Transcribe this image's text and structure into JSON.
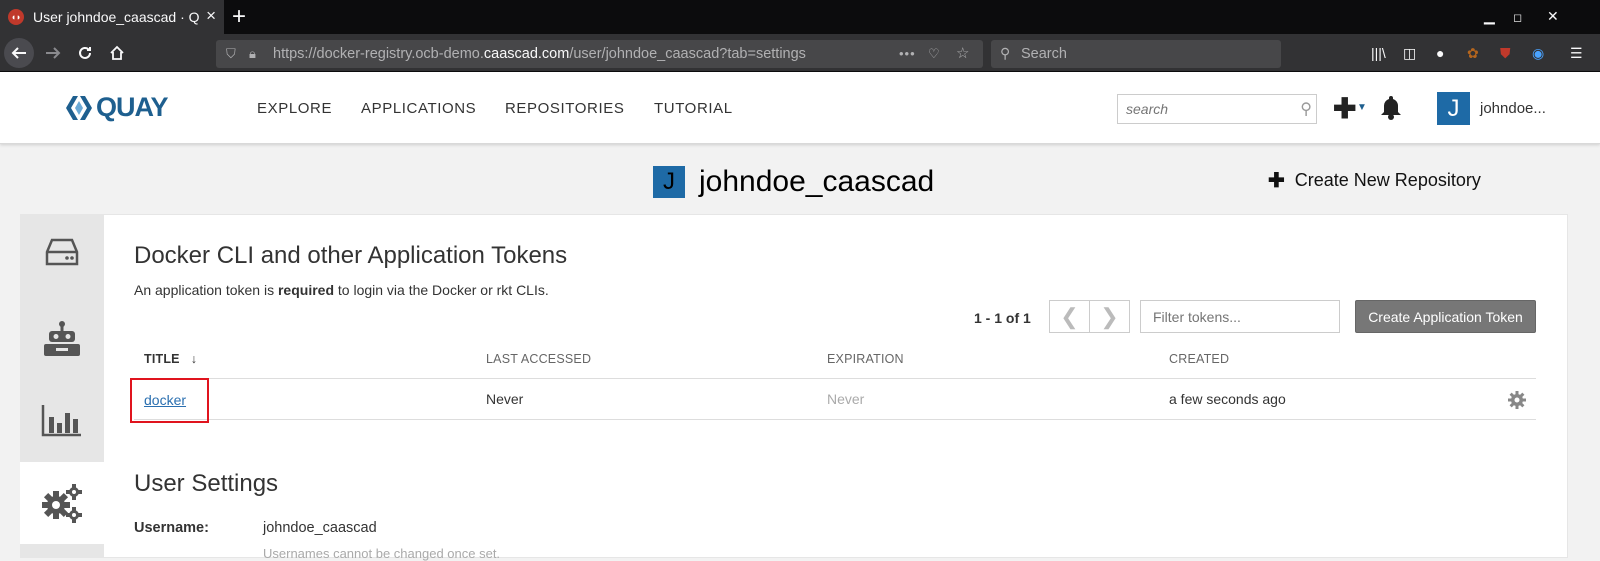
{
  "browser": {
    "tab_title": "User johndoe_caascad · Q",
    "tab_close": "×",
    "new_tab": "+",
    "url_prefix": "https://docker-registry.ocb-demo.",
    "url_domain": "caascad.com",
    "url_suffix": "/user/johndoe_caascad?tab=settings",
    "search_placeholder": "Search",
    "more": "•••"
  },
  "header": {
    "logo_text": "QUAY",
    "nav": [
      "EXPLORE",
      "APPLICATIONS",
      "REPOSITORIES",
      "TUTORIAL"
    ],
    "search_placeholder": "search",
    "avatar_letter": "J",
    "username": "johndoe..."
  },
  "page": {
    "avatar_letter": "J",
    "title": "johndoe_caascad",
    "create_repo_label": "Create New Repository"
  },
  "tokens": {
    "heading": "Docker CLI and other Application Tokens",
    "desc_pre": "An application token is ",
    "desc_bold": "required",
    "desc_post": " to login via the Docker or rkt CLIs.",
    "pager_count": "1 - 1 of 1",
    "prev": "❮",
    "next": "❯",
    "filter_placeholder": "Filter tokens...",
    "create_label": "Create Application Token",
    "columns": [
      "TITLE",
      "LAST ACCESSED",
      "EXPIRATION",
      "CREATED"
    ],
    "sort_arrow": "↓",
    "rows": [
      {
        "title": "docker",
        "last_accessed": "Never",
        "expiration": "Never",
        "created": "a few seconds ago"
      }
    ]
  },
  "settings": {
    "heading": "User Settings",
    "username_label": "Username:",
    "username_value": "johndoe_caascad",
    "username_help": "Usernames cannot be changed once set."
  },
  "colors": {
    "accent": "#1e6aa6",
    "link": "#2a6fb0",
    "highlight": "#e0141e"
  }
}
